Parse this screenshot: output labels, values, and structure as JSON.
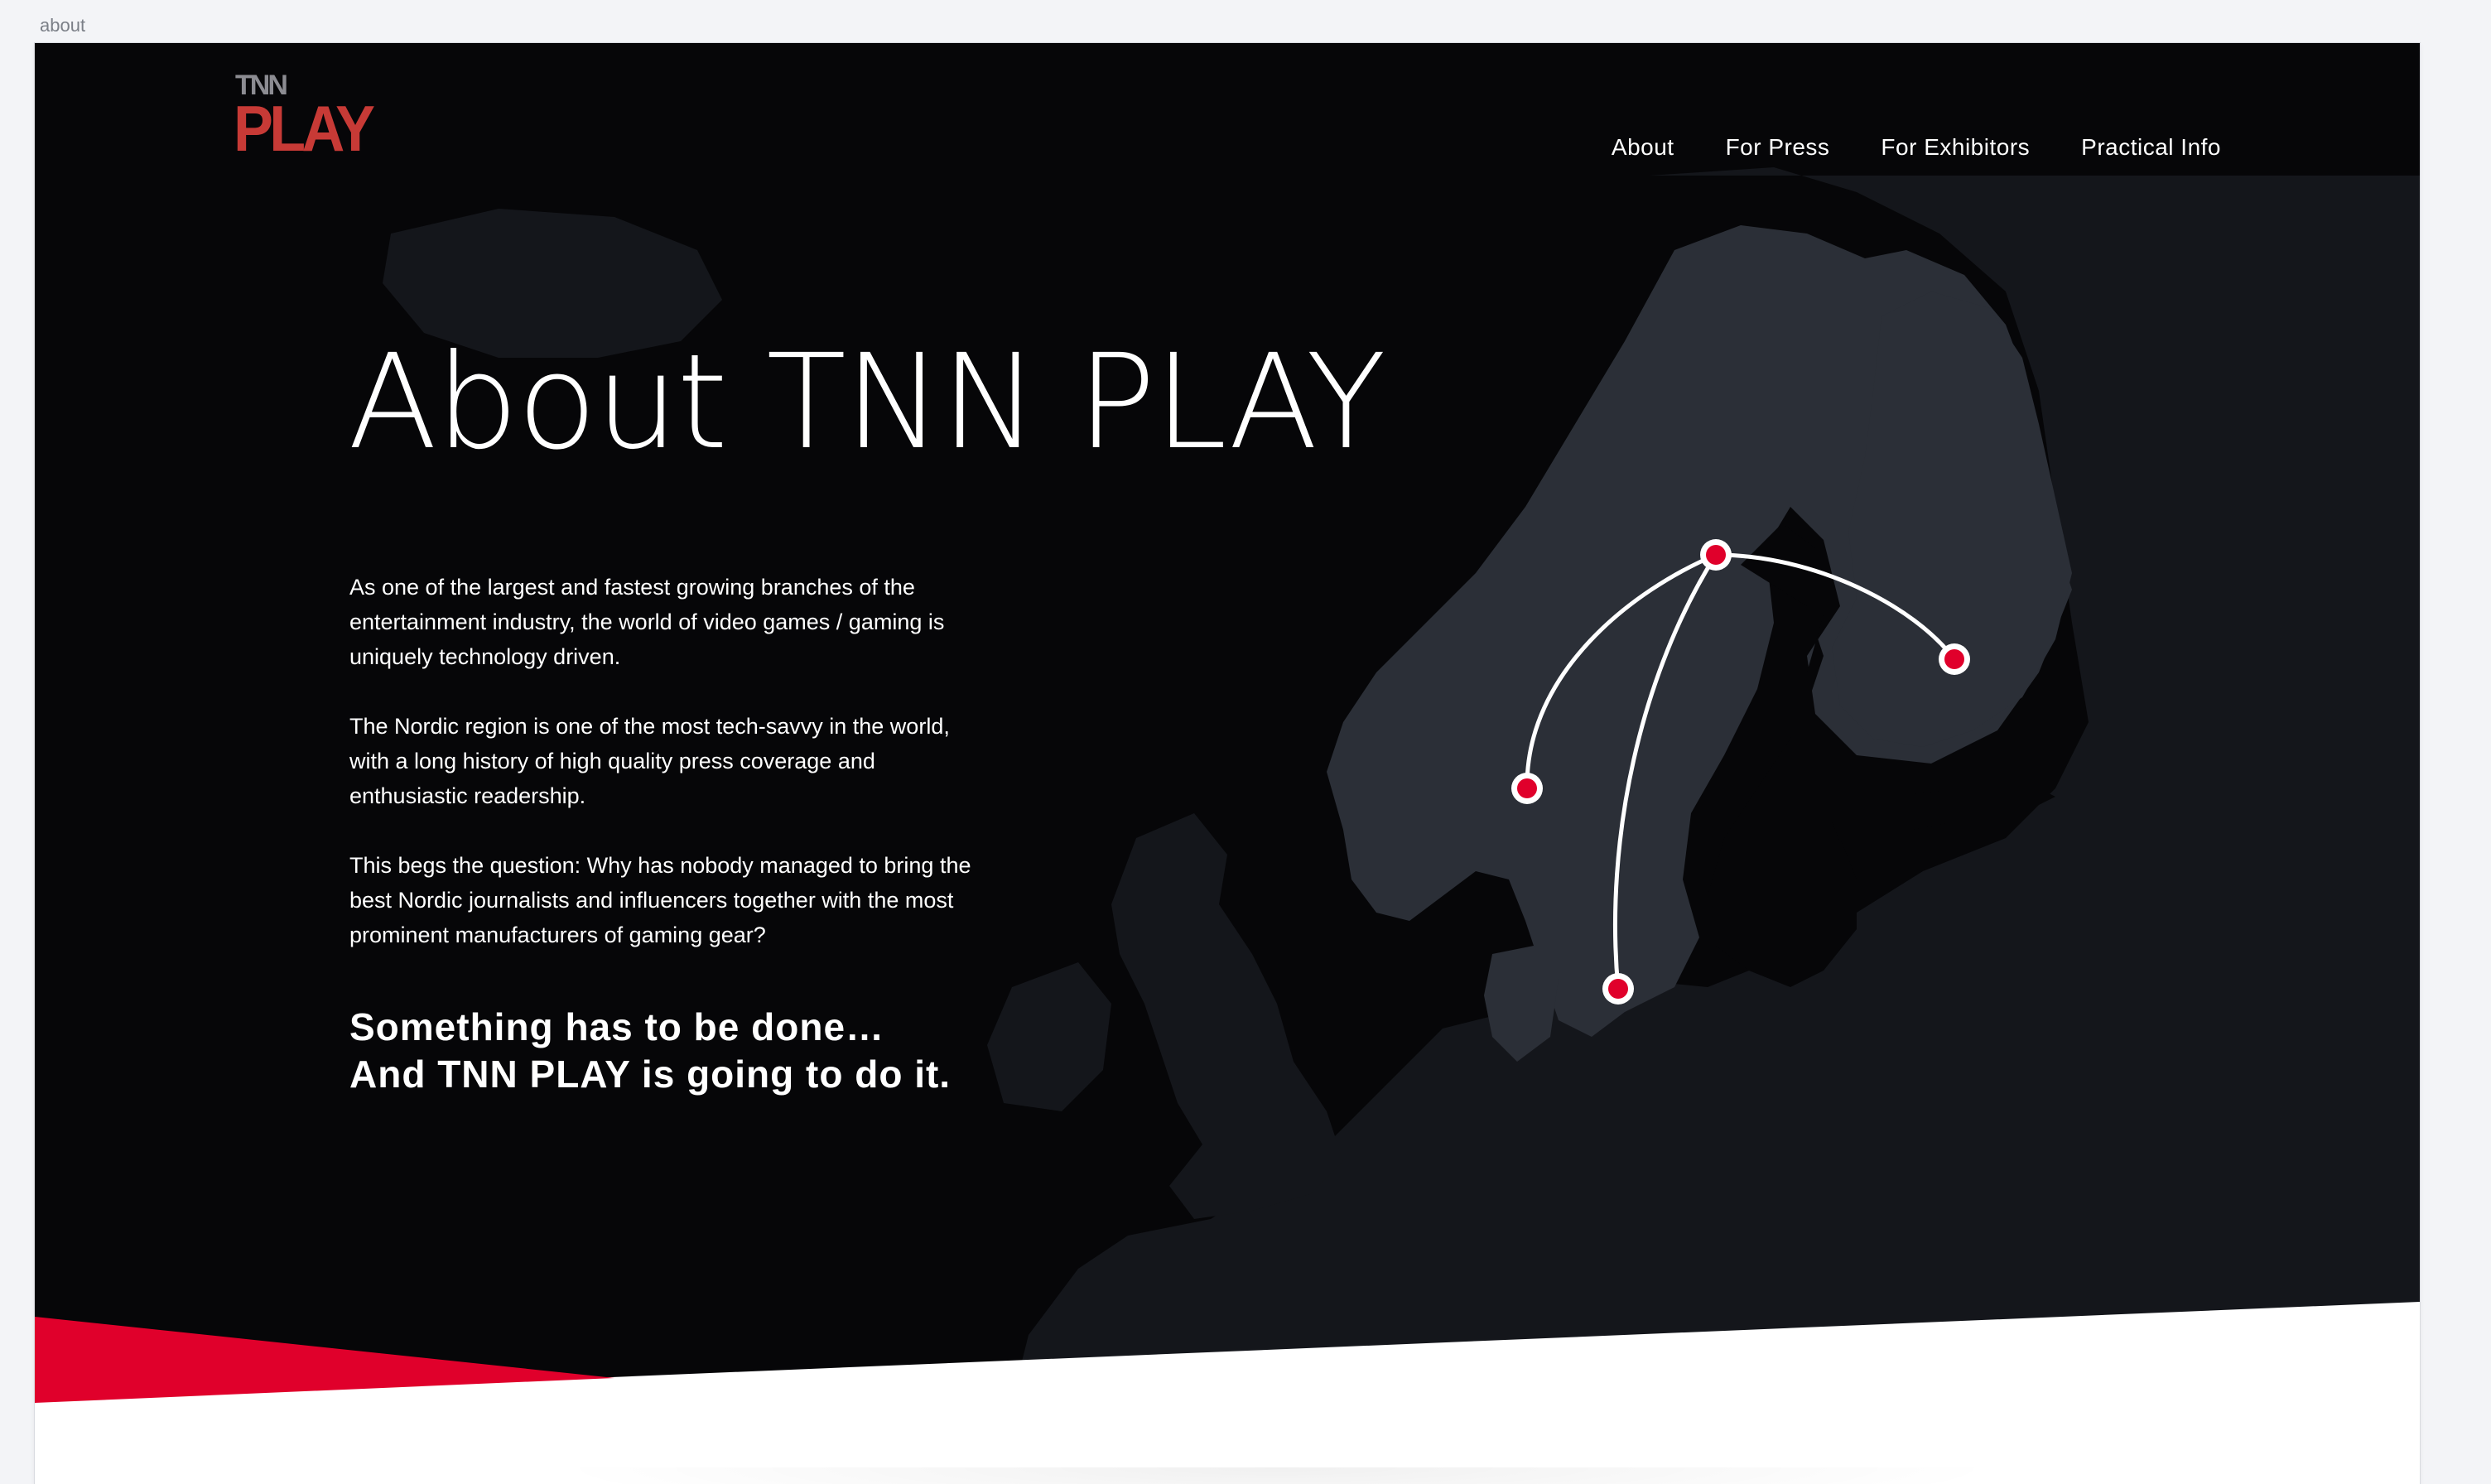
{
  "artboard": {
    "label": "about"
  },
  "logo": {
    "top": "TNN",
    "main": "PLAY"
  },
  "nav": {
    "items": [
      {
        "label": "About"
      },
      {
        "label": "For Press"
      },
      {
        "label": "For Exhibitors"
      },
      {
        "label": "Practical Info"
      }
    ]
  },
  "hero": {
    "title": "About TNN PLAY",
    "paragraphs": [
      "As one of the largest and fastest growing branches of the entertainment industry, the world of video games / gaming is uniquely technology driven.",
      "The Nordic region is one of the most tech-savvy in the world, with a long history of high quality press coverage and enthusiastic readership.",
      "This begs the question: Why has nobody managed to bring the best Nordic journalists and influencers together with the most prominent manufacturers of gaming gear?"
    ],
    "tagline": [
      "Something has to be done…",
      "And TNN PLAY is going to do it."
    ]
  },
  "colors": {
    "background": "#060608",
    "land": "#16181d",
    "nordic": "#2a2e36",
    "accent": "#e0002b",
    "logo_red": "#c73a36",
    "route": "#ffffff"
  }
}
